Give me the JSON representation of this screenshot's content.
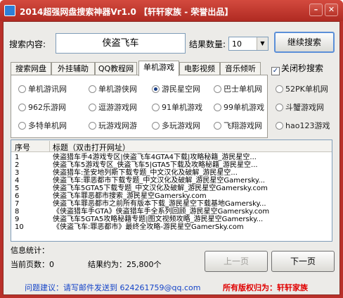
{
  "window": {
    "title": "2014超强网盘搜索神器Vr1.0 【轩轩家族 - 荣誉出品】",
    "minimize_label": "–",
    "close_label": "✕",
    "app_icon": "app-icon"
  },
  "search": {
    "label": "搜索内容:",
    "value": "侠盗飞车",
    "count_label": "结果数量:",
    "count_value": "10",
    "continue_label": "继续搜索"
  },
  "tabs": [
    "搜索网盘",
    "外挂辅助",
    "QQ教程网",
    "单机游戏",
    "电影视频",
    "音乐倾听"
  ],
  "active_tab": "单机游戏",
  "close_sec_search": {
    "label": "关闭秒搜索",
    "checked": true
  },
  "sites": [
    [
      "单机游讯网",
      "单机游侠网",
      "游民星空网",
      "巴士单机网",
      "52PK单机网"
    ],
    [
      "962乐游网",
      "逗游游戏网",
      "91单机游戏",
      "99单机游戏",
      "斗蟹游戏网"
    ],
    [
      "多特单机网",
      "玩游戏网游",
      "多玩游戏网",
      "飞翔游戏网",
      "hao123游戏"
    ]
  ],
  "selected_site": "游民星空网",
  "results": {
    "columns": [
      "序号",
      "标题（双击打开网址）"
    ],
    "rows": [
      {
        "idx": "1",
        "title": "侠盗猎车手4游戏专区|侠盗飞车4GTA4下载|攻略秘籍_游民星空..."
      },
      {
        "idx": "2",
        "title": "侠盗飞车5游戏专区_侠盗飞车5|GTA5下载及攻略秘籍_游民星空..."
      },
      {
        "idx": "3",
        "title": "侠盗猎车:圣安地列斯下载专题_中文汉化及破解_游民星空..."
      },
      {
        "idx": "4",
        "title": "侠盗飞车:罪恶都市下载专题_中文汉化及破解_游民星空Gamersky..."
      },
      {
        "idx": "5",
        "title": "侠盗飞车5GTA5下载专题_中文汉化及破解_游民星空Gamersky.com"
      },
      {
        "idx": "6",
        "title": "侠盗飞车罪恶都市搜索_游民星空Gamersky.com"
      },
      {
        "idx": "7",
        "title": "侠盗飞车罪恶都市之前所有版本下载_游民星空下载基地Gamersky..."
      },
      {
        "idx": "8",
        "title": "《侠盗猎车手GTA》侠盗猎车手全系列回顾_游民星空Gamersky.com"
      },
      {
        "idx": "9",
        "title": "侠盗飞车5GTA5攻略秘籍专题|图文视频攻略_游民星空Gamersky..."
      },
      {
        "idx": "10",
        "title": "《侠盗飞车:罪恶都市》最终全攻略-游民星空GamerSky.com"
      }
    ]
  },
  "stats": {
    "heading": "信息统计：",
    "page_label": "当前页数：0",
    "total_label": "结果约为：25,800个"
  },
  "pager": {
    "prev_label": "上一页",
    "next_label": "下一页"
  },
  "footer": {
    "feedback": "问题建议：请写邮件发送到 624261759@qq.com",
    "copyright": "所有版权归为：轩轩家族"
  },
  "colors": {
    "frame": "#b9302a",
    "footer_blue": "#1544c8",
    "footer_red": "#e00000"
  }
}
